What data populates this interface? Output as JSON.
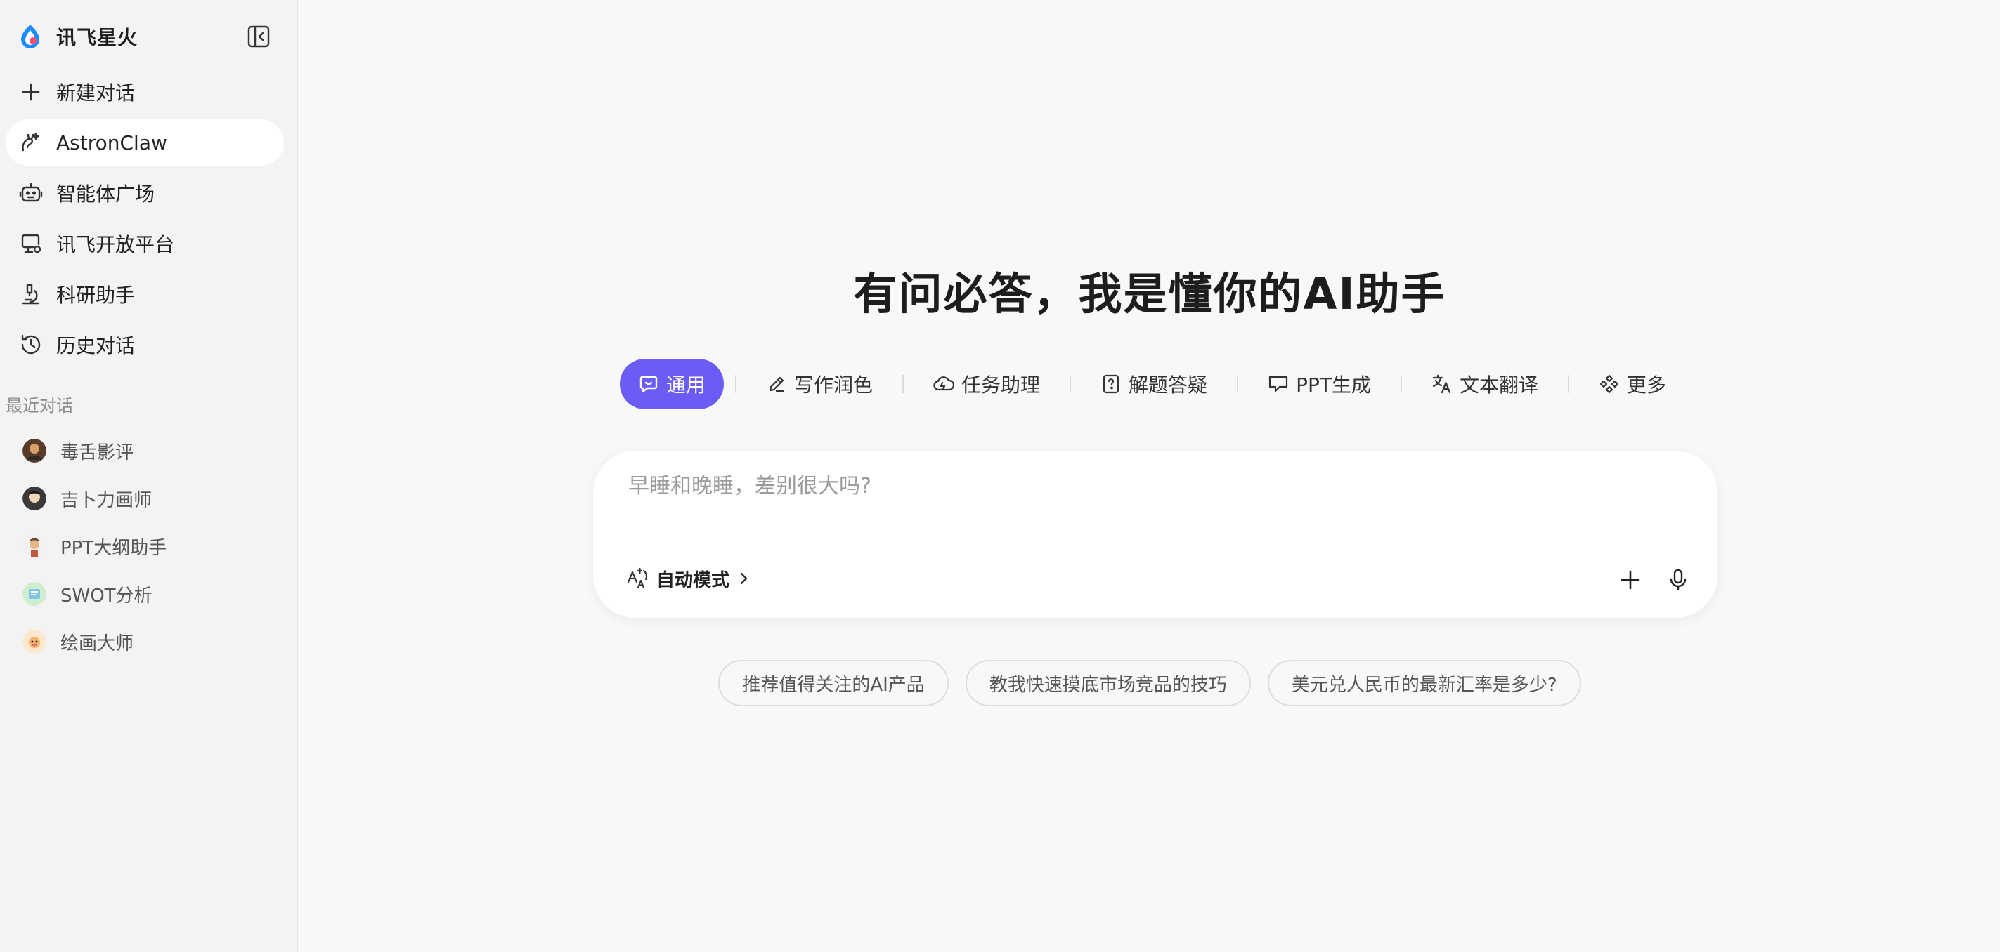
{
  "brand": {
    "name": "讯飞星火"
  },
  "sidebar": {
    "nav": [
      {
        "label": "新建对话",
        "icon": "plus-icon"
      },
      {
        "label": "AstronClaw",
        "icon": "claw-icon",
        "active": true
      },
      {
        "label": "智能体广场",
        "icon": "robot-icon"
      },
      {
        "label": "讯飞开放平台",
        "icon": "monitor-icon"
      },
      {
        "label": "科研助手",
        "icon": "microscope-icon"
      },
      {
        "label": "历史对话",
        "icon": "history-icon"
      }
    ],
    "recent_title": "最近对话",
    "recent": [
      {
        "label": "毒舌影评"
      },
      {
        "label": "吉卜力画师"
      },
      {
        "label": "PPT大纲助手"
      },
      {
        "label": "SWOT分析"
      },
      {
        "label": "绘画大师"
      }
    ]
  },
  "main": {
    "headline": "有问必答，我是懂你的AI助手",
    "tabs": [
      {
        "label": "通用",
        "icon": "chat-bubble-icon",
        "active": true
      },
      {
        "label": "写作润色",
        "icon": "pen-icon"
      },
      {
        "label": "任务助理",
        "icon": "cloud-icon"
      },
      {
        "label": "解题答疑",
        "icon": "question-doc-icon"
      },
      {
        "label": "PPT生成",
        "icon": "presentation-icon"
      },
      {
        "label": "文本翻译",
        "icon": "translate-icon"
      },
      {
        "label": "更多",
        "icon": "grid-diamond-icon"
      }
    ],
    "input": {
      "placeholder": "早睡和晚睡，差别很大吗?",
      "value": ""
    },
    "mode_label": "自动模式",
    "suggestions": [
      "推荐值得关注的AI产品",
      "教我快速摸底市场竞品的技巧",
      "美元兑人民币的最新汇率是多少?"
    ]
  },
  "colors": {
    "accent": "#6b5cf6",
    "sidebar_bg": "#f3f3f3",
    "page_bg": "#f8f8f8"
  }
}
